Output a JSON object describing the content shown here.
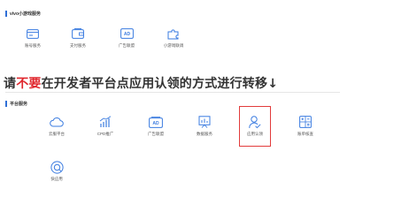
{
  "top_section": {
    "title": "vivo小游戏服务",
    "items": [
      {
        "label": "账号服务",
        "icon": "card-icon"
      },
      {
        "label": "支付服务",
        "icon": "wallet-icon"
      },
      {
        "label": "广告联盟",
        "icon": "ad-icon"
      },
      {
        "label": "小游戏联调",
        "icon": "puzzle-icon"
      }
    ]
  },
  "notice": {
    "prefix": "请",
    "highlight": "不要",
    "suffix": "在开发者平台点应用认领的方式进行转移↓",
    "highlight_color": "#e0282e"
  },
  "platform_section": {
    "title": "平台服务",
    "items": [
      {
        "label": "云服平台",
        "icon": "cloud-icon"
      },
      {
        "label": "CPD推广",
        "icon": "growth-chart-icon"
      },
      {
        "label": "广告联盟",
        "icon": "ad-icon"
      },
      {
        "label": "数据服务",
        "icon": "data-board-icon"
      },
      {
        "label": "应用认领",
        "icon": "user-check-icon",
        "highlighted": true
      },
      {
        "label": "账单核查",
        "icon": "calculator-icon"
      },
      {
        "label": "快应用",
        "icon": "quick-app-icon"
      }
    ]
  },
  "colors": {
    "accent": "#2f6fd6",
    "highlight_border": "#e23b3b",
    "icon_stroke": "#3a7be0"
  }
}
